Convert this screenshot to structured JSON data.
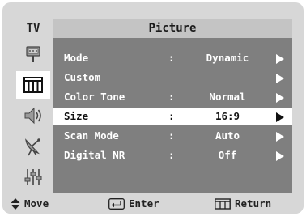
{
  "osd": {
    "source_label": "TV",
    "title": "Picture"
  },
  "side_icons": [
    {
      "name": "input-icon",
      "active": false
    },
    {
      "name": "picture-icon",
      "active": true
    },
    {
      "name": "sound-icon",
      "active": false
    },
    {
      "name": "channel-icon",
      "active": false
    },
    {
      "name": "setup-icon",
      "active": false
    }
  ],
  "menu": {
    "items": [
      {
        "label": "Mode",
        "separator": ":",
        "value": "Dynamic",
        "arrow": "right-arrow-icon",
        "selected": false
      },
      {
        "label": "Custom",
        "separator": "",
        "value": "",
        "arrow": "right-arrow-icon",
        "selected": false
      },
      {
        "label": "Color Tone",
        "separator": ":",
        "value": "Normal",
        "arrow": "right-arrow-icon",
        "selected": false
      },
      {
        "label": "Size",
        "separator": ":",
        "value": "16:9",
        "arrow": "right-arrow-icon",
        "selected": true
      },
      {
        "label": "Scan Mode",
        "separator": ":",
        "value": "Auto",
        "arrow": "right-arrow-icon",
        "selected": false
      },
      {
        "label": "Digital NR",
        "separator": ":",
        "value": "Off",
        "arrow": "right-arrow-icon",
        "selected": false
      }
    ]
  },
  "footer": {
    "move": "Move",
    "enter": "Enter",
    "return": "Return"
  },
  "colors": {
    "osd_background": "#d7d7d7",
    "panel_background": "#7f7f7f",
    "selected_row": "#ffffff",
    "text_light": "#ffffff",
    "text_dark": "#111111"
  }
}
